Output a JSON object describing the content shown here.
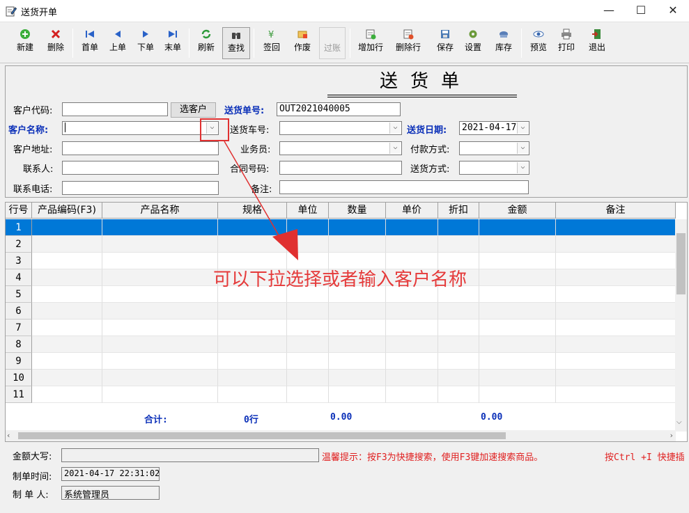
{
  "window": {
    "title": "送货开单"
  },
  "toolbar": {
    "new": "新建",
    "delete": "删除",
    "first": "首单",
    "prev": "上单",
    "next": "下单",
    "last": "末单",
    "refresh": "刷新",
    "find": "查找",
    "return": "签回",
    "void": "作废",
    "post": "过账",
    "add_row": "增加行",
    "delete_row": "删除行",
    "save": "保存",
    "settings": "设置",
    "stock": "库存",
    "preview": "预览",
    "print": "打印",
    "exit": "退出"
  },
  "form": {
    "doc_title": "送货单",
    "customer_code_label": "客户代码:",
    "select_customer_btn": "选客户",
    "delivery_no_label": "送货单号:",
    "delivery_no": "OUT2021040005",
    "customer_name_label": "客户名称:",
    "vehicle_label": "送货车号:",
    "delivery_date_label": "送货日期:",
    "delivery_date": "2021-04-17",
    "address_label": "客户地址:",
    "salesman_label": "业务员:",
    "payment_label": "付款方式:",
    "contact_label": "联系人:",
    "contract_label": "合同号码:",
    "shipping_label": "送货方式:",
    "phone_label": "联系电话:",
    "remark_label": "备注:"
  },
  "grid": {
    "headers": [
      "行号",
      "产品编码(F3)",
      "产品名称",
      "规格",
      "单位",
      "数量",
      "单价",
      "折扣",
      "金额",
      "备注"
    ],
    "rows": [
      "1",
      "2",
      "3",
      "4",
      "5",
      "6",
      "7",
      "8",
      "9",
      "10",
      "11"
    ],
    "total_label": "合计:",
    "total_rows": "0行",
    "total_qty": "0.00",
    "total_amount": "0.00"
  },
  "annotation": "可以下拉选择或者输入客户名称",
  "footer": {
    "amount_words_label": "金额大写:",
    "hint1": "温馨提示：按F3为快捷搜索，使用F3键加速搜索商品。",
    "hint2": "按Ctrl +I 快捷插",
    "created_time_label": "制单时间:",
    "created_time": "2021-04-17 22:31:02",
    "creator_label": "制 单 人:",
    "creator": "系统管理员"
  },
  "colors": {
    "accent": "#0078d7",
    "label_blue": "#0a2fb8",
    "annotation_red": "#e53a3a"
  }
}
